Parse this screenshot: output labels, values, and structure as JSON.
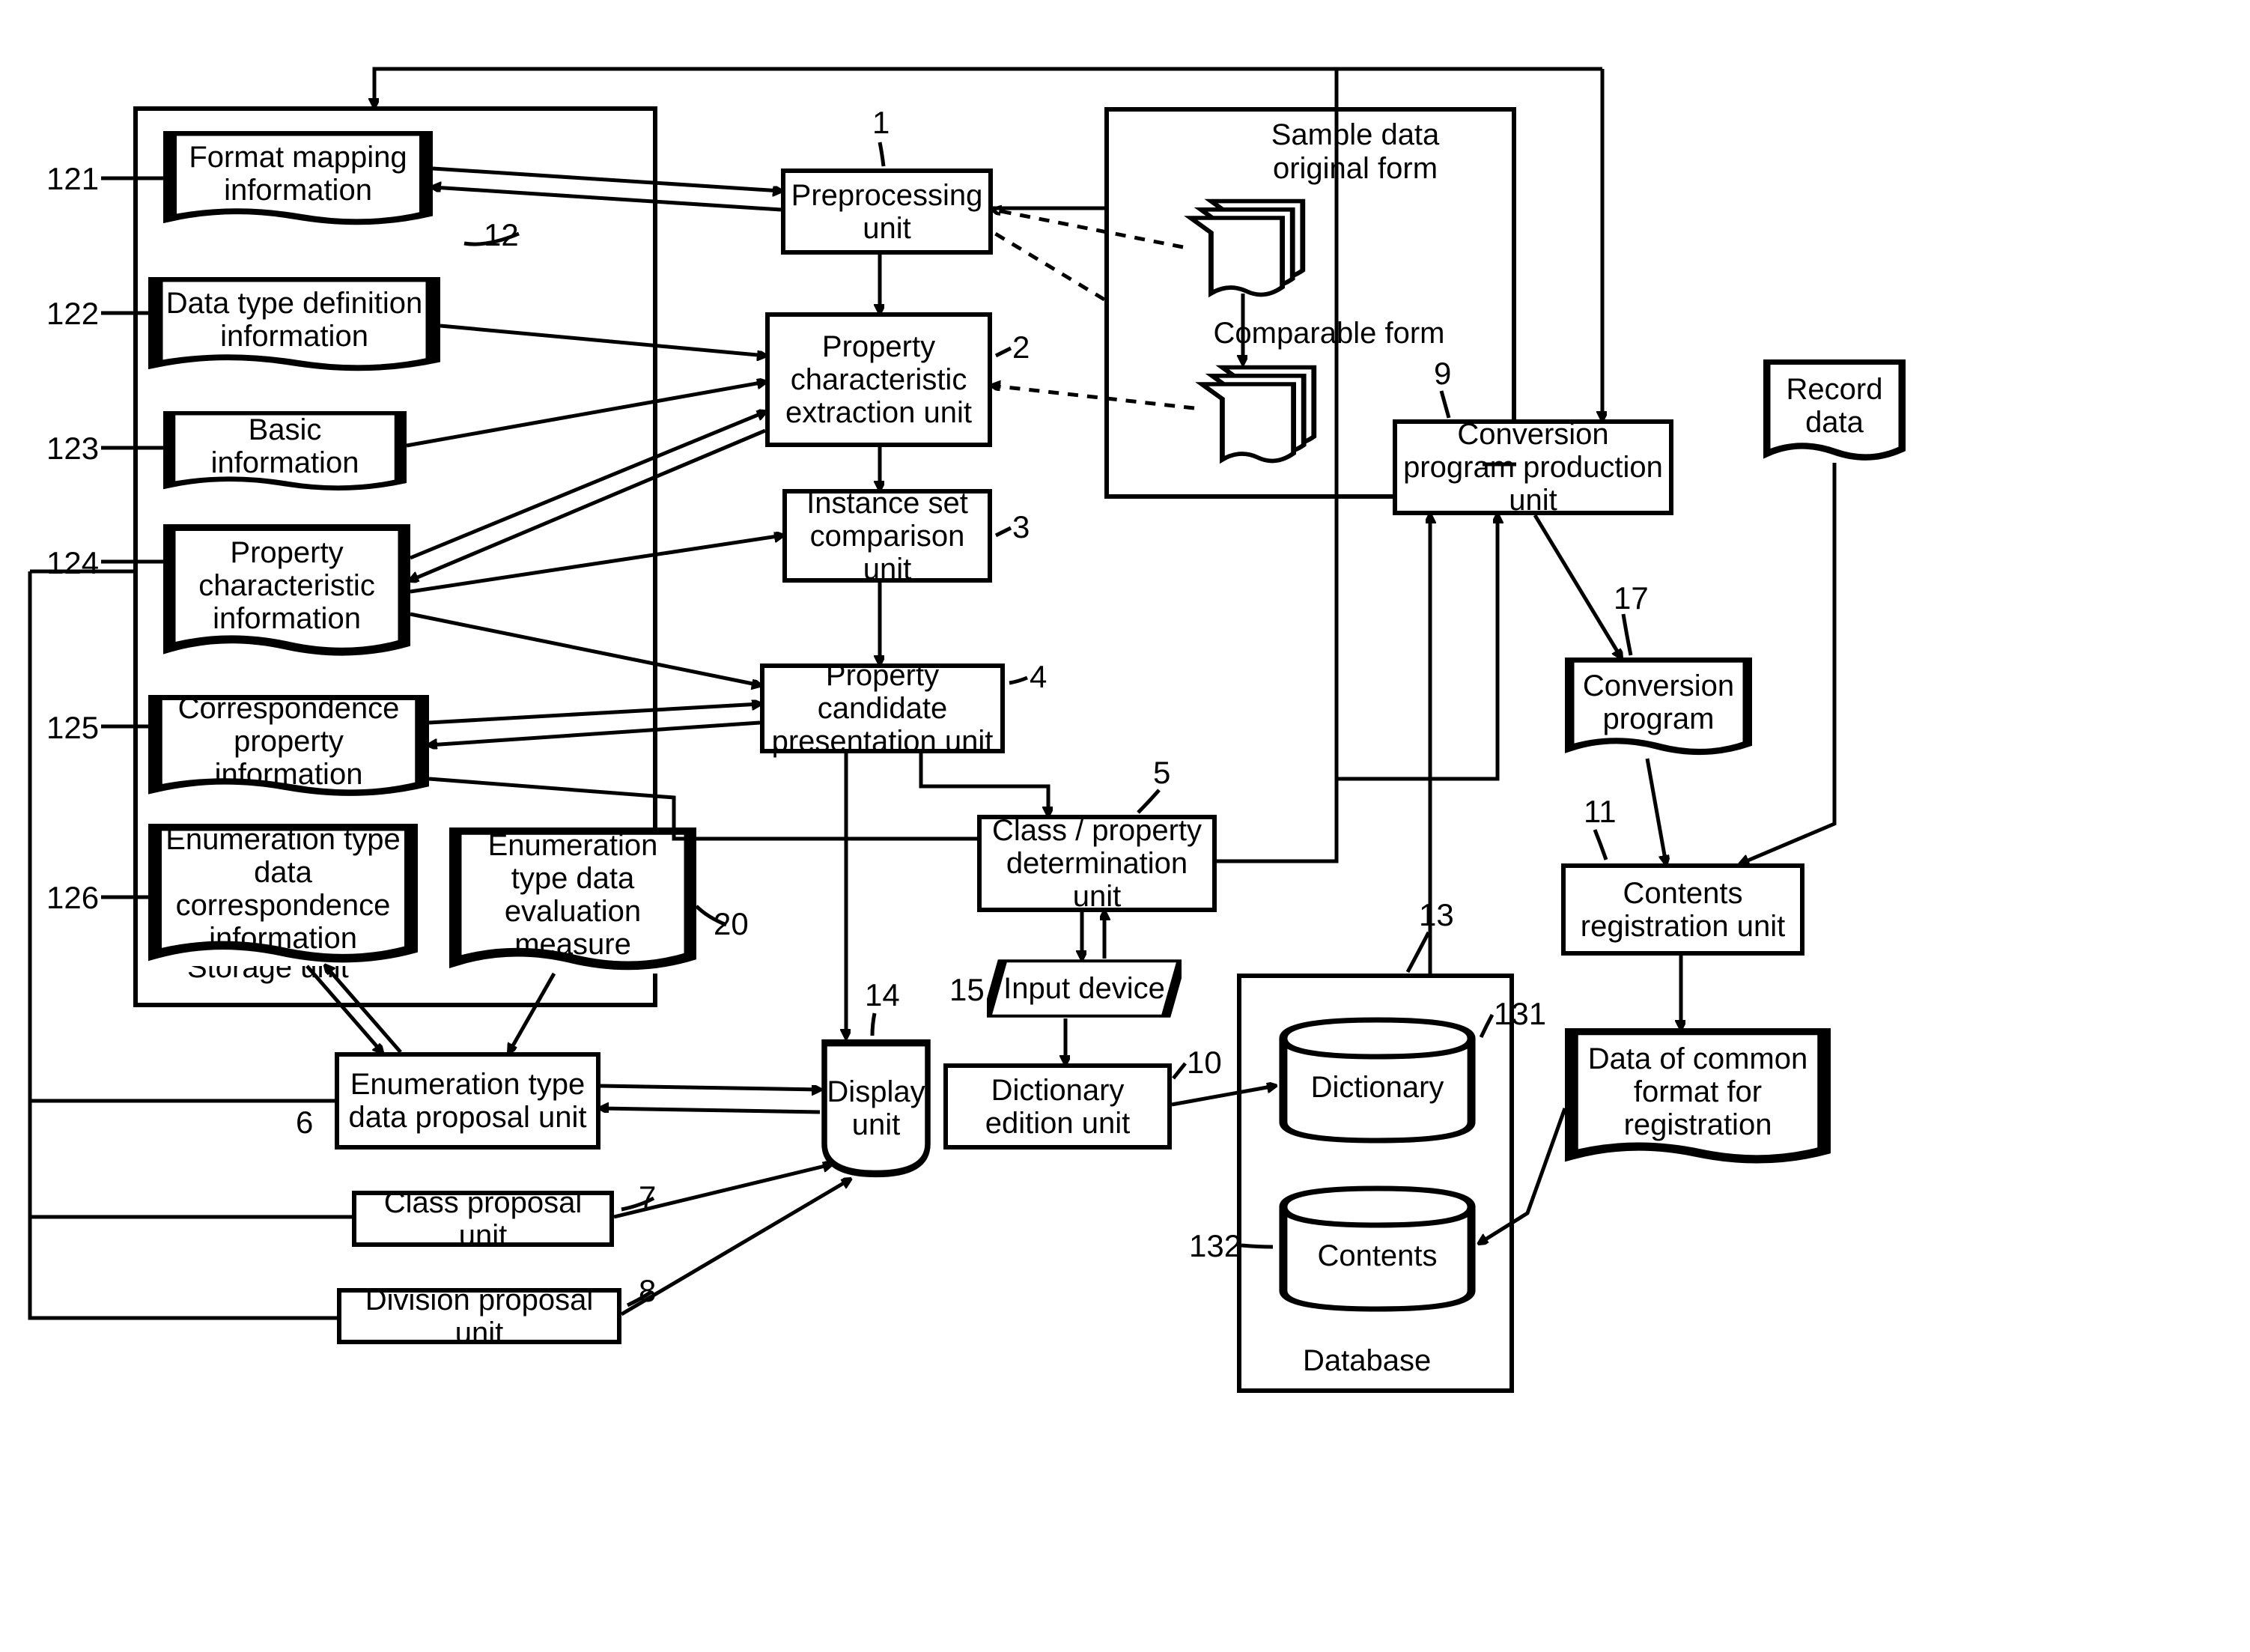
{
  "refs": {
    "r1": "1",
    "r2": "2",
    "r3": "3",
    "r4": "4",
    "r5": "5",
    "r6": "6",
    "r7": "7",
    "r8": "8",
    "r9": "9",
    "r10": "10",
    "r11": "11",
    "r12": "12",
    "r13": "13",
    "r14": "14",
    "r15": "15",
    "r17": "17",
    "r20": "20",
    "r121": "121",
    "r122": "122",
    "r123": "123",
    "r124": "124",
    "r125": "125",
    "r126": "126",
    "r131": "131",
    "r132": "132"
  },
  "storage": {
    "label": "Storage unit",
    "b121": "Format mapping information",
    "b122": "Data type definition information",
    "b123": "Basic information",
    "b124": "Property characteristic information",
    "b125": "Correspondence property information",
    "b126": "Enumeration type data correspondence information",
    "b20": "Enumeration type data evaluation measure"
  },
  "processing": {
    "b1": "Preprocessing unit",
    "b2": "Property characteristic extraction unit",
    "b3": "Instance set comparison unit",
    "b4": "Property candidate presentation unit",
    "b5": "Class / property determination unit",
    "b6": "Enumeration type data proposal unit",
    "b7": "Class proposal unit",
    "b8": "Division proposal unit",
    "b10": "Dictionary edition unit",
    "b14": "Display unit",
    "b15": "Input device"
  },
  "sample_area": {
    "original": "Sample data original form",
    "comparable": "Comparable form"
  },
  "right": {
    "b9": "Conversion program production unit",
    "b17": "Conversion program",
    "b11": "Contents registration unit",
    "out": "Data of common format for registration",
    "record": "Record data"
  },
  "db": {
    "label": "Database",
    "dict": "Dictionary",
    "contents": "Contents"
  }
}
